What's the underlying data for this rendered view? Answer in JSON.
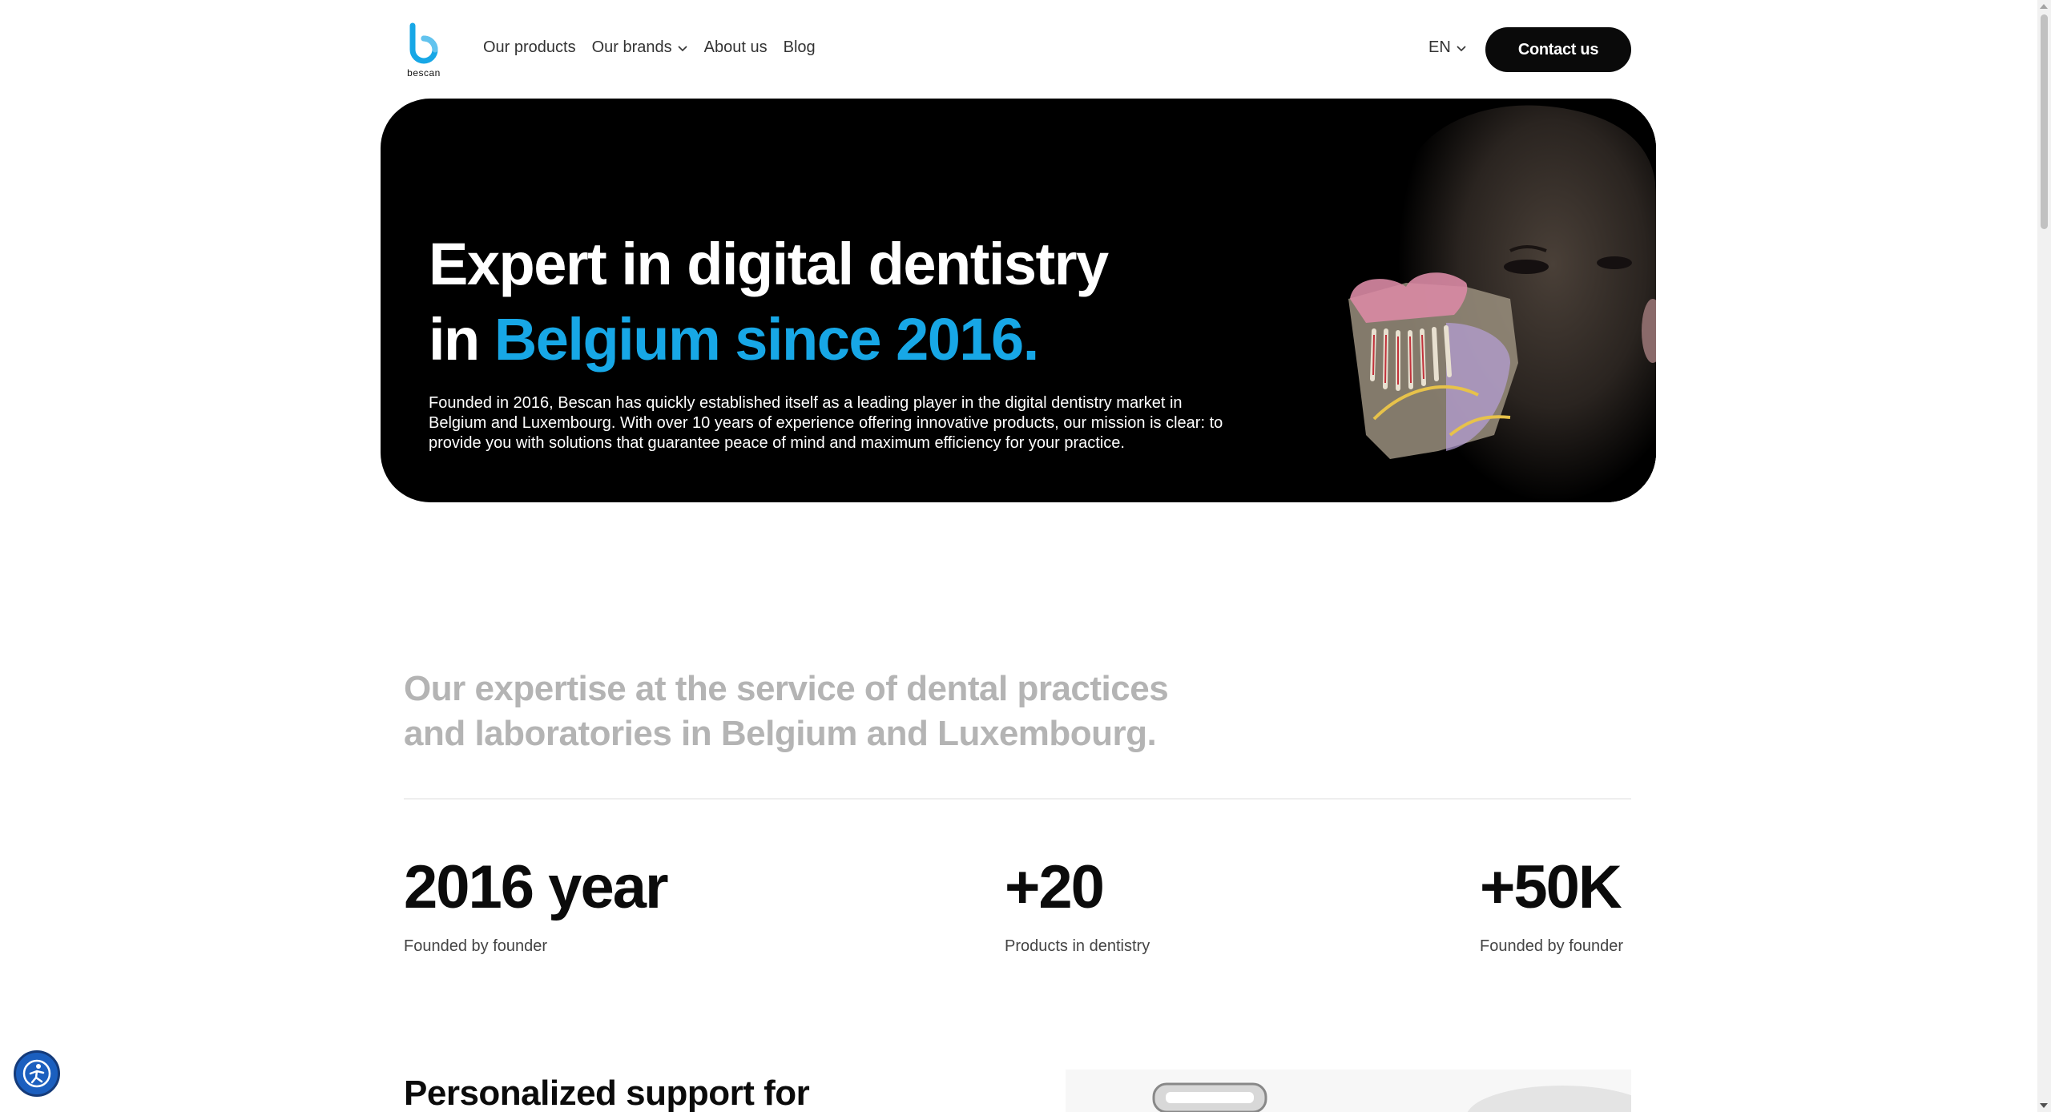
{
  "brand": {
    "name": "bescan",
    "accent_color": "#17a7e6"
  },
  "nav": {
    "items": [
      {
        "label": "Our products",
        "has_dropdown": false
      },
      {
        "label": "Our brands",
        "has_dropdown": true
      },
      {
        "label": "About us",
        "has_dropdown": false
      },
      {
        "label": "Blog",
        "has_dropdown": false
      }
    ],
    "language": "EN",
    "contact_label": "Contact us"
  },
  "hero": {
    "title_line1": "Expert in digital dentistry",
    "title_line2_prefix": "in ",
    "title_line2_accent": "Belgium since 2016.",
    "description": "Founded in 2016, Bescan has quickly established itself as a leading player in the digital dentistry market in Belgium and Luxembourg. With over 10 years of experience offering innovative products, our mission is clear: to provide you with solutions that guarantee peace of mind and maximum efficiency for your practice."
  },
  "expertise": {
    "heading_line1": "Our expertise at the service of dental practices",
    "heading_line2": "and laboratories in Belgium and Luxembourg."
  },
  "stats": [
    {
      "value": "2016 year",
      "label": "Founded by founder"
    },
    {
      "value": "+20",
      "label": "Products in dentistry"
    },
    {
      "value": "+50K",
      "label": "Founded by founder"
    }
  ],
  "support": {
    "heading": "Personalized support for"
  },
  "icons": {
    "logo": "bescan-logo",
    "dropdown": "chevron-down-icon",
    "accessibility": "accessibility-icon"
  }
}
